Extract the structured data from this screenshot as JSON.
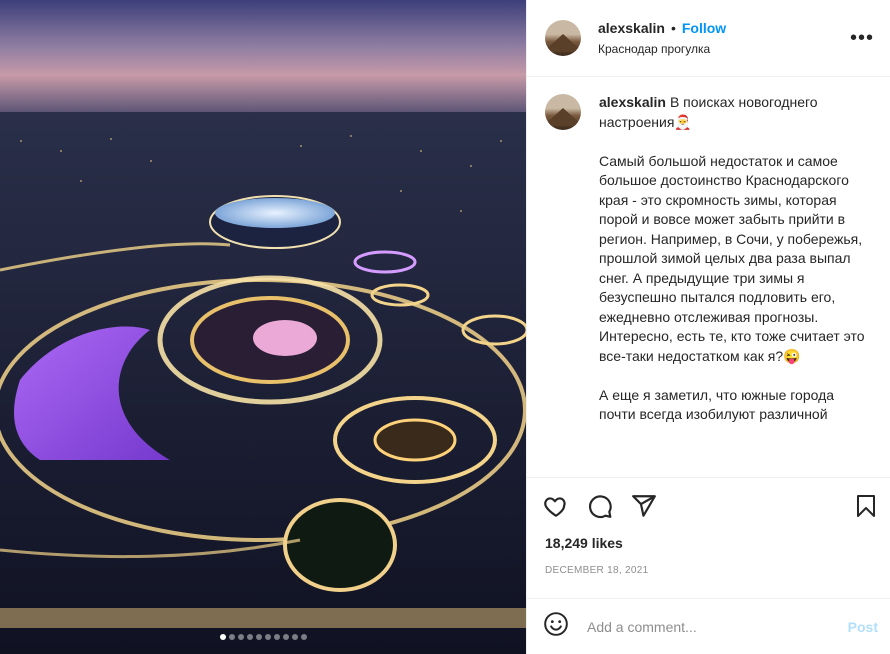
{
  "header": {
    "username": "alexskalin",
    "separator": "•",
    "follow_label": "Follow",
    "location": "Краснодар прогулка",
    "more_icon": "more-horizontal-icon",
    "more_label": "•••"
  },
  "caption": {
    "username": "alexskalin",
    "text": "В поисках новогоднего настроения🎅\n\nСамый большой недостаток и самое большое достоинство Краснодарского края - это скромность зимы, которая порой и вовсе может забыть прийти в регион. Например, в Сочи, у побережья, прошлой зимой целых два раза выпал снег. А предыдущие три зимы я безуспешно пытался подловить его, ежедневно отслеживая прогнозы. Интересно, есть те, кто тоже считает это все-таки недостатком как я?😜\n\nА еще я заметил, что южные города почти всегда изобилуют различной"
  },
  "actions": {
    "like_icon": "heart-icon",
    "comment_icon": "comment-icon",
    "share_icon": "share-icon",
    "save_icon": "bookmark-icon"
  },
  "likes": "18,249 likes",
  "date": "DECEMBER 18, 2021",
  "comment_box": {
    "emoji_icon": "emoji-icon",
    "placeholder": "Add a comment...",
    "post_label": "Post"
  },
  "carousel": {
    "total": 10,
    "active_index": 1
  },
  "colors": {
    "accent": "#0095f6",
    "post_disabled": "#b2dffc",
    "muted": "#8e8e8e",
    "divider": "#efefef"
  }
}
